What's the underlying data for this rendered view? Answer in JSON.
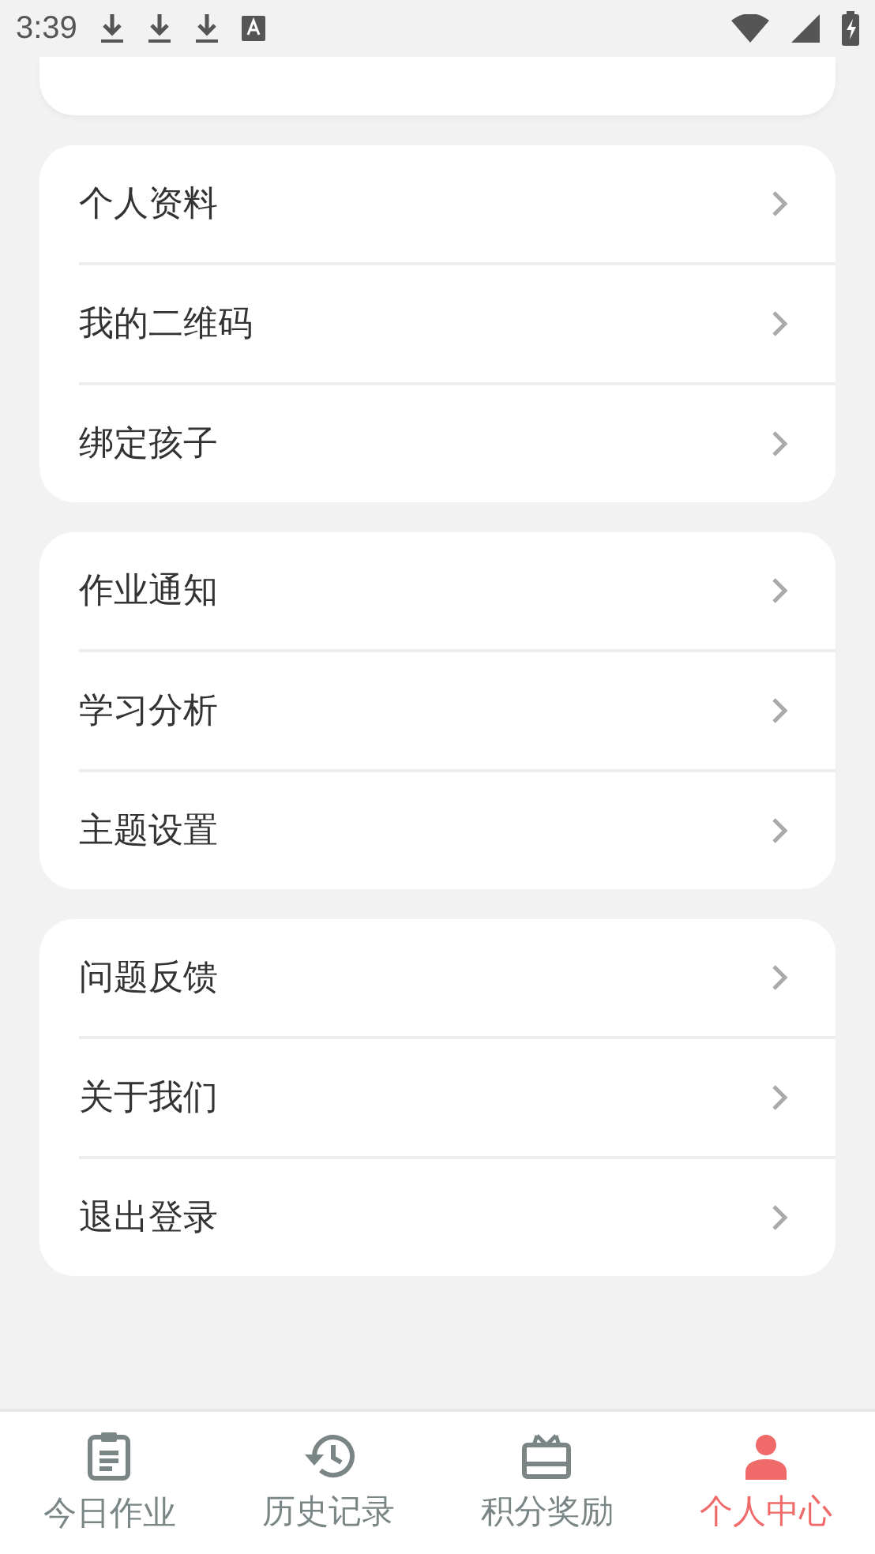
{
  "status_bar": {
    "time": "3:39"
  },
  "groups": [
    [
      {
        "label": "个人资料"
      },
      {
        "label": "我的二维码"
      },
      {
        "label": "绑定孩子"
      }
    ],
    [
      {
        "label": "作业通知"
      },
      {
        "label": "学习分析"
      },
      {
        "label": "主题设置"
      }
    ],
    [
      {
        "label": "问题反馈"
      },
      {
        "label": "关于我们"
      },
      {
        "label": "退出登录"
      }
    ]
  ],
  "tabs": [
    {
      "kind": "clipboard",
      "label": "今日作业",
      "selected": false
    },
    {
      "kind": "history",
      "label": "历史记录",
      "selected": false
    },
    {
      "kind": "gift",
      "label": "积分奖励",
      "selected": false
    },
    {
      "kind": "person",
      "label": "个人中心",
      "selected": true
    }
  ]
}
